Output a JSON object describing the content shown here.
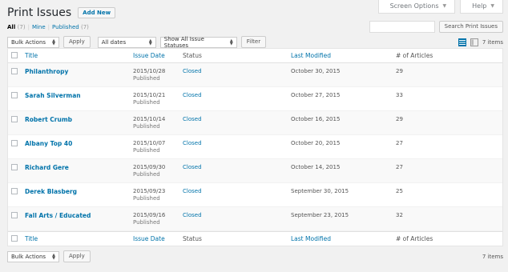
{
  "screen_tabs": {
    "screen_options": "Screen Options",
    "help": "Help"
  },
  "page": {
    "title": "Print Issues",
    "add_new": "Add New"
  },
  "views": {
    "all": "All",
    "all_count": "(7)",
    "mine": "Mine",
    "published": "Published",
    "published_count": "(7)"
  },
  "search": {
    "value": "",
    "button": "Search Print Issues"
  },
  "tablenav_top": {
    "bulk_actions": "Bulk Actions",
    "apply": "Apply",
    "dates": "All dates",
    "statuses": "Show All Issue Statuses",
    "filter": "Filter",
    "items": "7 items"
  },
  "tablenav_bottom": {
    "bulk_actions": "Bulk Actions",
    "apply": "Apply",
    "items": "7 items"
  },
  "columns": {
    "title": "Title",
    "issue_date": "Issue Date",
    "status": "Status",
    "last_modified": "Last Modified",
    "articles": "# of Articles"
  },
  "rows": [
    {
      "title": "Philanthropy",
      "date": "2015/10/28",
      "state": "Published",
      "status": "Closed",
      "modified": "October 30, 2015",
      "articles": "29"
    },
    {
      "title": "Sarah Silverman",
      "date": "2015/10/21",
      "state": "Published",
      "status": "Closed",
      "modified": "October 27, 2015",
      "articles": "33"
    },
    {
      "title": "Robert Crumb",
      "date": "2015/10/14",
      "state": "Published",
      "status": "Closed",
      "modified": "October 16, 2015",
      "articles": "29"
    },
    {
      "title": "Albany Top 40",
      "date": "2015/10/07",
      "state": "Published",
      "status": "Closed",
      "modified": "October 20, 2015",
      "articles": "27"
    },
    {
      "title": "Richard Gere",
      "date": "2015/09/30",
      "state": "Published",
      "status": "Closed",
      "modified": "October 14, 2015",
      "articles": "27"
    },
    {
      "title": "Derek Blasberg",
      "date": "2015/09/23",
      "state": "Published",
      "status": "Closed",
      "modified": "September 30, 2015",
      "articles": "25"
    },
    {
      "title": "Fall Arts / Educated",
      "date": "2015/09/16",
      "state": "Published",
      "status": "Closed",
      "modified": "September 23, 2015",
      "articles": "32"
    }
  ],
  "colors": {
    "link": "#0073aa",
    "background": "#f1f1f1",
    "alt_row": "#f9f9f9"
  }
}
